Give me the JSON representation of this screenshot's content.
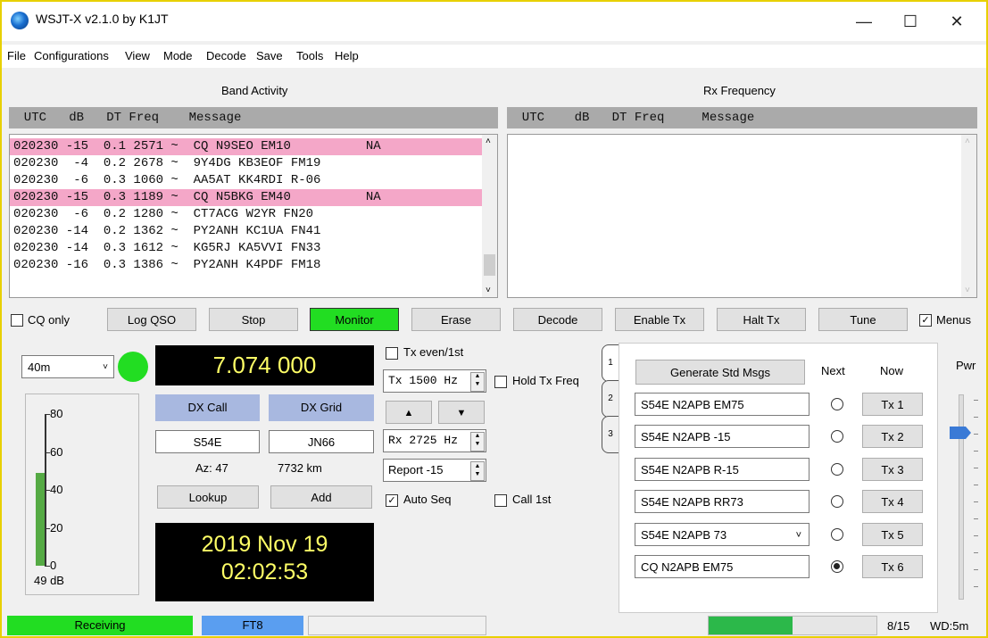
{
  "window": {
    "title": "WSJT-X   v2.1.0   by K1JT",
    "minimize": "—",
    "maximize": "☐",
    "close": "✕"
  },
  "menu": [
    "File",
    "Configurations",
    "View",
    "Mode",
    "Decode",
    "Save",
    "Tools",
    "Help"
  ],
  "band_activity": {
    "title": "Band Activity",
    "header": "  UTC   dB   DT Freq    Message",
    "rows": [
      {
        "text": "020230 -15  0.1 2571 ~  CQ N9SEO EM10          NA",
        "cq": true
      },
      {
        "text": "020230  -4  0.2 2678 ~  9Y4DG KB3EOF FM19",
        "cq": false
      },
      {
        "text": "020230  -6  0.3 1060 ~  AA5AT KK4RDI R-06",
        "cq": false
      },
      {
        "text": "020230 -15  0.3 1189 ~  CQ N5BKG EM40          NA",
        "cq": true
      },
      {
        "text": "020230  -6  0.2 1280 ~  CT7ACG W2YR FN20",
        "cq": false
      },
      {
        "text": "020230 -14  0.2 1362 ~  PY2ANH KC1UA FN41",
        "cq": false
      },
      {
        "text": "020230 -14  0.3 1612 ~  KG5RJ KA5VVI FN33",
        "cq": false
      },
      {
        "text": "020230 -16  0.3 1386 ~  PY2ANH K4PDF FM18",
        "cq": false
      }
    ]
  },
  "rx_frequency": {
    "title": "Rx Frequency",
    "header": "  UTC    dB   DT Freq     Message"
  },
  "buttons": {
    "cq_only": "CQ only",
    "log_qso": "Log QSO",
    "stop": "Stop",
    "monitor": "Monitor",
    "erase": "Erase",
    "decode": "Decode",
    "enable_tx": "Enable Tx",
    "halt_tx": "Halt Tx",
    "tune": "Tune",
    "menus": "Menus"
  },
  "band": "40m",
  "frequency": "7.074 000",
  "dx": {
    "call_label": "DX Call",
    "grid_label": "DX Grid",
    "call": "S54E",
    "grid": "JN66",
    "az": "Az: 47",
    "dist": "7732 km",
    "lookup": "Lookup",
    "add": "Add"
  },
  "level": {
    "ticks": [
      "80",
      "60",
      "40",
      "20",
      "0"
    ],
    "value": "49 dB",
    "fill_fraction": 0.61
  },
  "clock": {
    "date": "2019 Nov 19",
    "time": "02:02:53"
  },
  "tx_controls": {
    "tx_even": "Tx even/1st",
    "tx_hz": "Tx  1500  Hz",
    "hold_tx": "Hold Tx Freq",
    "rx_hz": "Rx  2725  Hz",
    "report": "Report -15",
    "auto_seq": "Auto Seq",
    "call_1st": "Call 1st"
  },
  "tabs": [
    "1",
    "2",
    "3"
  ],
  "messages": {
    "generate": "Generate Std Msgs",
    "next": "Next",
    "now": "Now",
    "items": [
      {
        "text": "S54E N2APB EM75",
        "tx": "Tx 1",
        "selected": false
      },
      {
        "text": "S54E N2APB -15",
        "tx": "Tx 2",
        "selected": false
      },
      {
        "text": "S54E N2APB R-15",
        "tx": "Tx 3",
        "selected": false
      },
      {
        "text": "S54E N2APB RR73",
        "tx": "Tx 4",
        "selected": false
      },
      {
        "text": "S54E N2APB 73",
        "tx": "Tx 5",
        "selected": false
      },
      {
        "text": "CQ N2APB EM75",
        "tx": "Tx 6",
        "selected": true
      }
    ]
  },
  "pwr": "Pwr",
  "status": {
    "receiving": "Receiving",
    "mode": "FT8",
    "progress": "8/15",
    "wd": "WD:5m",
    "progress_fraction": 0.5
  },
  "colors": {
    "green": "#22dd22",
    "cq_pink": "#f4a7c8",
    "blue_btn": "#a8b8e0",
    "freq_fg": "#ffff66",
    "accent": "#3a7ad6"
  }
}
